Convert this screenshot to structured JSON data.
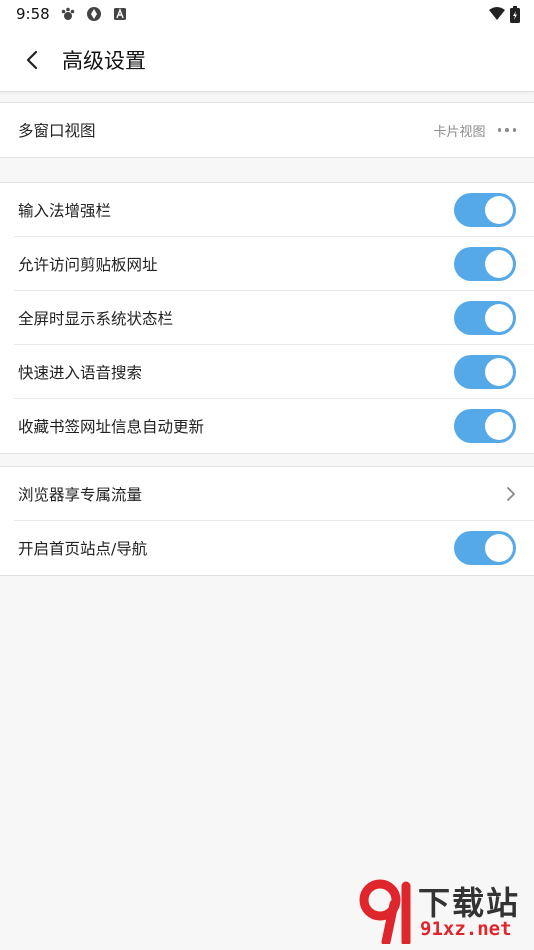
{
  "status_bar": {
    "time": "9:58",
    "icons": [
      "notification-paw-icon",
      "sync-icon",
      "app-a-icon"
    ],
    "right_icons": [
      "wifi-icon",
      "battery-icon"
    ]
  },
  "header": {
    "title": "高级设置",
    "back_icon": "chevron-left-icon"
  },
  "sections": {
    "view": {
      "item_label": "多窗口视图",
      "item_value": "卡片视图"
    },
    "toggles": {
      "items": [
        {
          "label": "输入法增强栏",
          "on": true
        },
        {
          "label": "允许访问剪贴板网址",
          "on": true
        },
        {
          "label": "全屏时显示系统状态栏",
          "on": true
        },
        {
          "label": "快速进入语音搜索",
          "on": true
        },
        {
          "label": "收藏书签网址信息自动更新",
          "on": true
        }
      ]
    },
    "misc": {
      "traffic_label": "浏览器享专属流量",
      "nav_label": "开启首页站点/导航",
      "nav_on": true
    }
  },
  "watermark": {
    "line1": "下载站",
    "line2": "91xz.net"
  },
  "colors": {
    "toggle_on": "#56a9e8",
    "background": "#f7f7f7",
    "accent_red": "#e0262d"
  }
}
